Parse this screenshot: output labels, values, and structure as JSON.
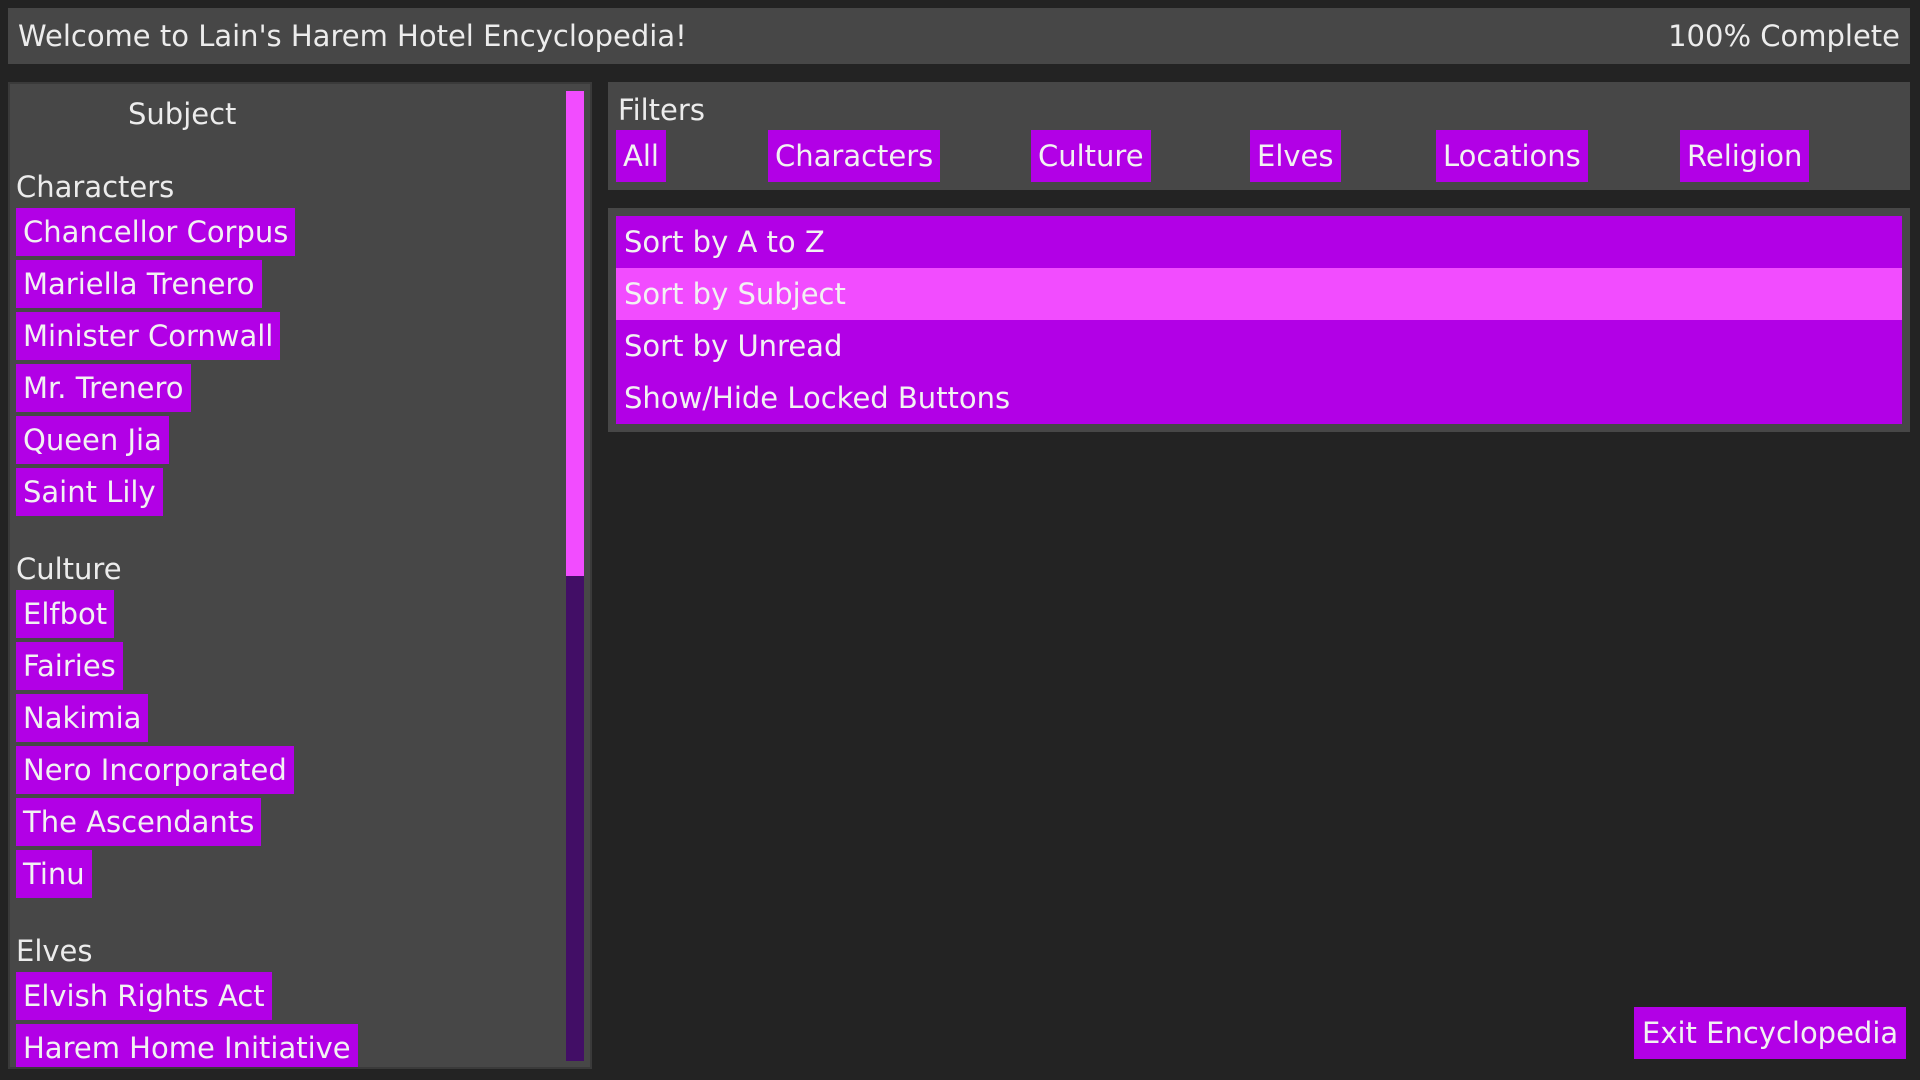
{
  "header": {
    "title": "Welcome to Lain's Harem Hotel Encyclopedia!",
    "progress": "100% Complete"
  },
  "subject_panel": {
    "title": "Subject",
    "categories": [
      {
        "label": "Characters",
        "entries": [
          "Chancellor Corpus",
          "Mariella Trenero",
          "Minister Cornwall",
          "Mr. Trenero",
          "Queen Jia",
          "Saint Lily"
        ]
      },
      {
        "label": "Culture",
        "entries": [
          "Elfbot",
          "Fairies",
          "Nakimia",
          "Nero Incorporated",
          "The Ascendants",
          "Tinu"
        ]
      },
      {
        "label": "Elves",
        "entries": [
          "Elvish Rights Act",
          "Harem Home Initiative"
        ]
      }
    ],
    "scroll_fraction_visible": 0.5
  },
  "filters": {
    "label": "Filters",
    "buttons": [
      "All",
      "Characters",
      "Culture",
      "Elves",
      "Locations",
      "Religion"
    ]
  },
  "sort_options": [
    {
      "label": "Sort by A to Z",
      "active": false
    },
    {
      "label": "Sort by Subject",
      "active": true
    },
    {
      "label": "Sort by Unread",
      "active": false
    },
    {
      "label": "Show/Hide Locked Buttons",
      "active": false
    }
  ],
  "exit_button": "Exit Encyclopedia",
  "colors": {
    "button": "#b200e6",
    "active": "#f24cff",
    "panel": "#474747",
    "background": "#232323",
    "scroll_track": "#420e66"
  }
}
